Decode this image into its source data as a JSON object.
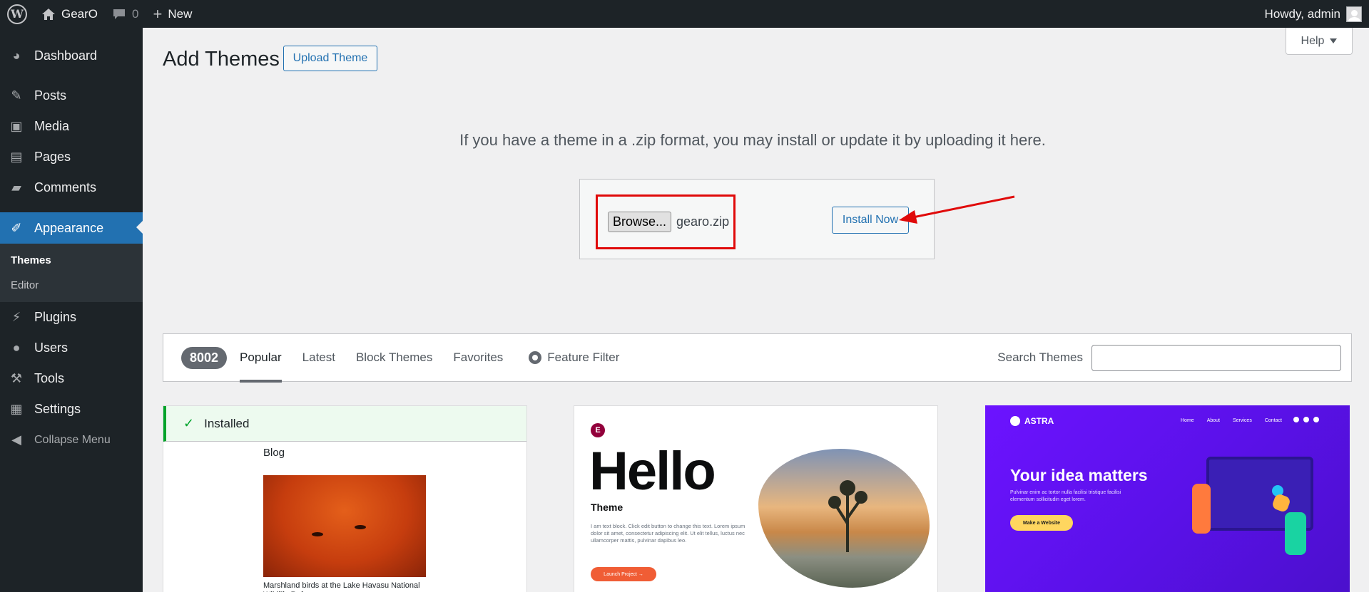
{
  "adminbar": {
    "site_name": "GearO",
    "comments_count": "0",
    "new_label": "New",
    "greeting": "Howdy, admin"
  },
  "sidebar": {
    "items": [
      {
        "label": "Dashboard",
        "icon": "dashboard-icon"
      },
      {
        "label": "Posts",
        "icon": "pin-icon"
      },
      {
        "label": "Media",
        "icon": "media-icon"
      },
      {
        "label": "Pages",
        "icon": "pages-icon"
      },
      {
        "label": "Comments",
        "icon": "comment-icon"
      },
      {
        "label": "Appearance",
        "icon": "brush-icon"
      },
      {
        "label": "Plugins",
        "icon": "plug-icon"
      },
      {
        "label": "Users",
        "icon": "user-icon"
      },
      {
        "label": "Tools",
        "icon": "wrench-icon"
      },
      {
        "label": "Settings",
        "icon": "settings-icon"
      }
    ],
    "submenu": [
      "Themes",
      "Editor"
    ],
    "collapse_label": "Collapse Menu"
  },
  "main": {
    "title": "Add Themes",
    "upload_button": "Upload Theme",
    "help_label": "Help",
    "upload_description": "If you have a theme in a .zip format, you may install or update it by uploading it here.",
    "browse_label": "Browse...",
    "file_name": "gearo.zip",
    "install_button": "Install Now"
  },
  "filter": {
    "count": "8002",
    "tabs": [
      "Popular",
      "Latest",
      "Block Themes",
      "Favorites"
    ],
    "feature_filter": "Feature Filter",
    "search_label": "Search Themes",
    "search_value": ""
  },
  "themes": {
    "installed_label": "Installed",
    "blog_title": "Blog",
    "blog_caption": "Marshland birds at the Lake Havasu National Wildlife Refuge",
    "hello_title": "Hello",
    "hello_subtitle": "Theme",
    "hello_text": "I am text block. Click edit button to change this text. Lorem ipsum dolor sit amet, consectetur adipiscing elit. Ut elit tellus, luctus nec ullamcorper mattis, pulvinar dapibus leo.",
    "hello_button": "Launch Project  →",
    "astra_logo": "ASTRA",
    "astra_nav": [
      "Home",
      "About",
      "Services",
      "Contact"
    ],
    "astra_title": "Your idea matters",
    "astra_desc": "Pulvinar enim ac tortor nulla facilisi tristique facilisi elementum sollicitudin eget lorem.",
    "astra_button": "Make a Website"
  },
  "colors": {
    "admin_dark": "#1d2327",
    "accent_blue": "#2271b1",
    "highlight_red": "#e00a0a",
    "installed_green": "#00a32a"
  }
}
